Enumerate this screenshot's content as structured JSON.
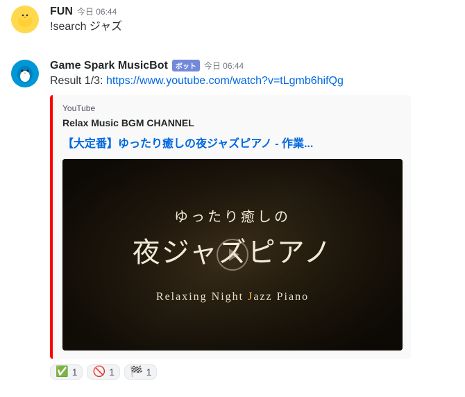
{
  "msg1": {
    "username": "FUN",
    "timestamp": "今日 06:44",
    "content": "!search ジャズ"
  },
  "msg2": {
    "username": "Game Spark MusicBot",
    "botTag": "ボット",
    "timestamp": "今日 06:44",
    "resultPrefix": "Result 1/3: ",
    "url": "https://www.youtube.com/watch?v=tLgmb6hifQg",
    "embed": {
      "provider": "YouTube",
      "author": "Relax Music BGM CHANNEL",
      "title": "【大定番】ゆったり癒しの夜ジャズピアノ - 作業...",
      "thumbSub": "ゆったり癒しの",
      "thumbMain": "夜ジャズピアノ",
      "thumbEnPrefix": "Relaxing  Night ",
      "thumbEnJazz": "J",
      "thumbEnJazzRest": "azz",
      "thumbEnSuffix": "  Piano"
    },
    "reactions": [
      {
        "emoji": "✅",
        "count": "1"
      },
      {
        "emoji": "🚫",
        "count": "1"
      },
      {
        "emoji": "🏁",
        "count": "1"
      }
    ]
  }
}
